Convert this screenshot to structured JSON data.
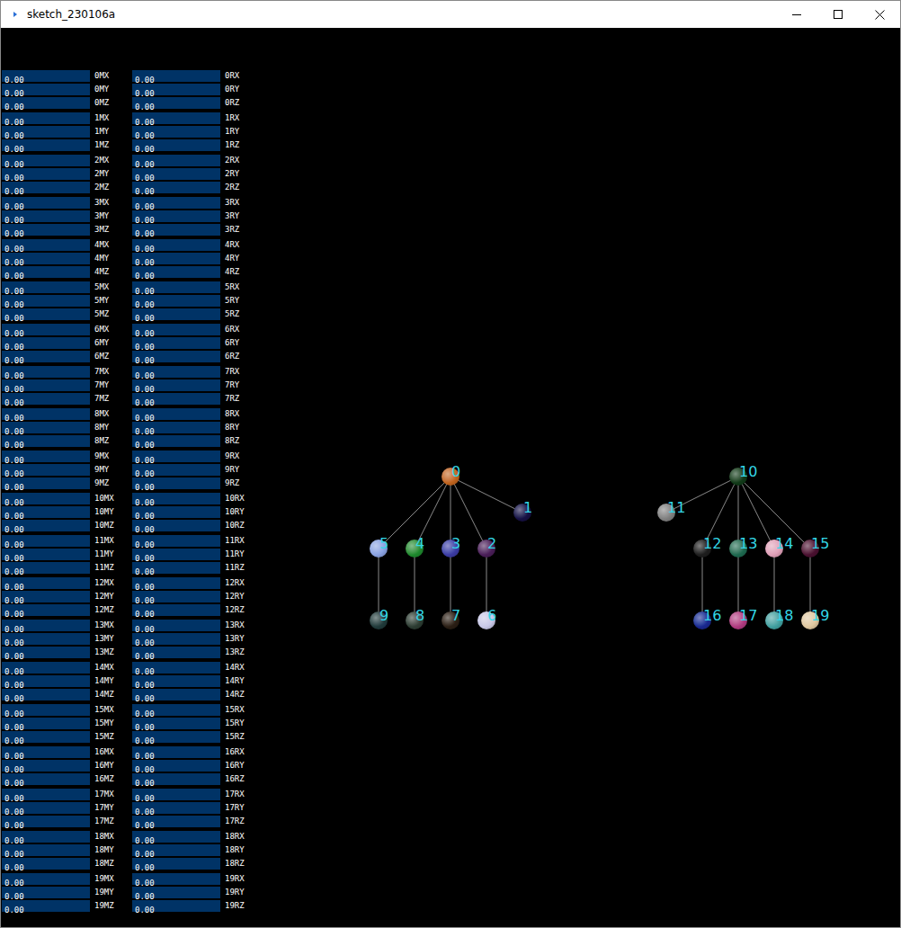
{
  "window": {
    "title": "sketch_230106a"
  },
  "slider_groups": [
    {
      "rows": [
        {
          "move": {
            "value": "0.00",
            "label": "0MX",
            "level": 0
          },
          "rotate": {
            "value": "0.00",
            "label": "0RX",
            "level": 0
          }
        },
        {
          "move": {
            "value": "0.00",
            "label": "0MY",
            "level": 0
          },
          "rotate": {
            "value": "0.00",
            "label": "0RY",
            "level": 0
          }
        },
        {
          "move": {
            "value": "0.00",
            "label": "0MZ",
            "level": 0
          },
          "rotate": {
            "value": "0.00",
            "label": "0RZ",
            "level": 0
          }
        }
      ]
    },
    {
      "rows": [
        {
          "move": {
            "value": "0.00",
            "label": "1MX",
            "level": 0
          },
          "rotate": {
            "value": "0.00",
            "label": "1RX",
            "level": 0
          }
        },
        {
          "move": {
            "value": "0.00",
            "label": "1MY",
            "level": 0
          },
          "rotate": {
            "value": "0.00",
            "label": "1RY",
            "level": 0
          }
        },
        {
          "move": {
            "value": "0.00",
            "label": "1MZ",
            "level": 0
          },
          "rotate": {
            "value": "0.00",
            "label": "1RZ",
            "level": 0
          }
        }
      ]
    },
    {
      "rows": [
        {
          "move": {
            "value": "0.00",
            "label": "2MX",
            "level": 0
          },
          "rotate": {
            "value": "0.00",
            "label": "2RX",
            "level": 0
          }
        },
        {
          "move": {
            "value": "0.00",
            "label": "2MY",
            "level": 0
          },
          "rotate": {
            "value": "0.00",
            "label": "2RY",
            "level": 0
          }
        },
        {
          "move": {
            "value": "0.00",
            "label": "2MZ",
            "level": 0
          },
          "rotate": {
            "value": "0.00",
            "label": "2RZ",
            "level": 0
          }
        }
      ]
    },
    {
      "rows": [
        {
          "move": {
            "value": "0.00",
            "label": "3MX",
            "level": 0
          },
          "rotate": {
            "value": "0.00",
            "label": "3RX",
            "level": 0
          }
        },
        {
          "move": {
            "value": "0.00",
            "label": "3MY",
            "level": 0
          },
          "rotate": {
            "value": "0.00",
            "label": "3RY",
            "level": 0
          }
        },
        {
          "move": {
            "value": "0.00",
            "label": "3MZ",
            "level": 0
          },
          "rotate": {
            "value": "0.00",
            "label": "3RZ",
            "level": 0
          }
        }
      ]
    },
    {
      "rows": [
        {
          "move": {
            "value": "0.00",
            "label": "4MX",
            "level": 0
          },
          "rotate": {
            "value": "0.00",
            "label": "4RX",
            "level": 0
          }
        },
        {
          "move": {
            "value": "0.00",
            "label": "4MY",
            "level": 0
          },
          "rotate": {
            "value": "0.00",
            "label": "4RY",
            "level": 0
          }
        },
        {
          "move": {
            "value": "0.00",
            "label": "4MZ",
            "level": 0
          },
          "rotate": {
            "value": "0.00",
            "label": "4RZ",
            "level": 0
          }
        }
      ]
    },
    {
      "rows": [
        {
          "move": {
            "value": "0.00",
            "label": "5MX",
            "level": 0
          },
          "rotate": {
            "value": "0.00",
            "label": "5RX",
            "level": 0
          }
        },
        {
          "move": {
            "value": "0.00",
            "label": "5MY",
            "level": 0
          },
          "rotate": {
            "value": "0.00",
            "label": "5RY",
            "level": 0
          }
        },
        {
          "move": {
            "value": "0.00",
            "label": "5MZ",
            "level": 0
          },
          "rotate": {
            "value": "0.00",
            "label": "5RZ",
            "level": 0
          }
        }
      ]
    },
    {
      "rows": [
        {
          "move": {
            "value": "0.00",
            "label": "6MX",
            "level": 0
          },
          "rotate": {
            "value": "0.00",
            "label": "6RX",
            "level": 0
          }
        },
        {
          "move": {
            "value": "0.00",
            "label": "6MY",
            "level": 0
          },
          "rotate": {
            "value": "0.00",
            "label": "6RY",
            "level": 0
          }
        },
        {
          "move": {
            "value": "0.00",
            "label": "6MZ",
            "level": 0
          },
          "rotate": {
            "value": "0.00",
            "label": "6RZ",
            "level": 0
          }
        }
      ]
    },
    {
      "rows": [
        {
          "move": {
            "value": "0.00",
            "label": "7MX",
            "level": 0
          },
          "rotate": {
            "value": "0.00",
            "label": "7RX",
            "level": 0
          }
        },
        {
          "move": {
            "value": "0.00",
            "label": "7MY",
            "level": 0
          },
          "rotate": {
            "value": "0.00",
            "label": "7RY",
            "level": 0
          }
        },
        {
          "move": {
            "value": "0.00",
            "label": "7MZ",
            "level": 0
          },
          "rotate": {
            "value": "0.00",
            "label": "7RZ",
            "level": 0
          }
        }
      ]
    },
    {
      "rows": [
        {
          "move": {
            "value": "0.00",
            "label": "8MX",
            "level": 0
          },
          "rotate": {
            "value": "0.00",
            "label": "8RX",
            "level": 0
          }
        },
        {
          "move": {
            "value": "0.00",
            "label": "8MY",
            "level": 0
          },
          "rotate": {
            "value": "0.00",
            "label": "8RY",
            "level": 0
          }
        },
        {
          "move": {
            "value": "0.00",
            "label": "8MZ",
            "level": 0
          },
          "rotate": {
            "value": "0.00",
            "label": "8RZ",
            "level": 0
          }
        }
      ]
    },
    {
      "rows": [
        {
          "move": {
            "value": "0.00",
            "label": "9MX",
            "level": 0
          },
          "rotate": {
            "value": "0.00",
            "label": "9RX",
            "level": 0
          }
        },
        {
          "move": {
            "value": "0.00",
            "label": "9MY",
            "level": 0
          },
          "rotate": {
            "value": "0.00",
            "label": "9RY",
            "level": 0
          }
        },
        {
          "move": {
            "value": "0.00",
            "label": "9MZ",
            "level": 0
          },
          "rotate": {
            "value": "0.00",
            "label": "9RZ",
            "level": 0
          }
        }
      ]
    },
    {
      "rows": [
        {
          "move": {
            "value": "0.00",
            "label": "10MX",
            "level": 0
          },
          "rotate": {
            "value": "0.00",
            "label": "10RX",
            "level": 0
          }
        },
        {
          "move": {
            "value": "0.00",
            "label": "10MY",
            "level": 0
          },
          "rotate": {
            "value": "0.00",
            "label": "10RY",
            "level": 0
          }
        },
        {
          "move": {
            "value": "0.00",
            "label": "10MZ",
            "level": 0
          },
          "rotate": {
            "value": "0.00",
            "label": "10RZ",
            "level": 0
          }
        }
      ]
    },
    {
      "rows": [
        {
          "move": {
            "value": "0.00",
            "label": "11MX",
            "level": 0
          },
          "rotate": {
            "value": "0.00",
            "label": "11RX",
            "level": 0
          }
        },
        {
          "move": {
            "value": "0.00",
            "label": "11MY",
            "level": 0
          },
          "rotate": {
            "value": "0.00",
            "label": "11RY",
            "level": 0
          }
        },
        {
          "move": {
            "value": "0.00",
            "label": "11MZ",
            "level": 0
          },
          "rotate": {
            "value": "0.00",
            "label": "11RZ",
            "level": 0
          }
        }
      ]
    },
    {
      "rows": [
        {
          "move": {
            "value": "0.00",
            "label": "12MX",
            "level": 0
          },
          "rotate": {
            "value": "0.00",
            "label": "12RX",
            "level": 0
          }
        },
        {
          "move": {
            "value": "0.00",
            "label": "12MY",
            "level": 0
          },
          "rotate": {
            "value": "0.00",
            "label": "12RY",
            "level": 0
          }
        },
        {
          "move": {
            "value": "0.00",
            "label": "12MZ",
            "level": 0
          },
          "rotate": {
            "value": "0.00",
            "label": "12RZ",
            "level": 0
          }
        }
      ]
    },
    {
      "rows": [
        {
          "move": {
            "value": "0.00",
            "label": "13MX",
            "level": 0
          },
          "rotate": {
            "value": "0.00",
            "label": "13RX",
            "level": 0
          }
        },
        {
          "move": {
            "value": "0.00",
            "label": "13MY",
            "level": 0
          },
          "rotate": {
            "value": "0.00",
            "label": "13RY",
            "level": 0
          }
        },
        {
          "move": {
            "value": "0.00",
            "label": "13MZ",
            "level": 0
          },
          "rotate": {
            "value": "0.00",
            "label": "13RZ",
            "level": 0
          }
        }
      ]
    },
    {
      "rows": [
        {
          "move": {
            "value": "0.00",
            "label": "14MX",
            "level": 0
          },
          "rotate": {
            "value": "0.00",
            "label": "14RX",
            "level": 0
          }
        },
        {
          "move": {
            "value": "0.00",
            "label": "14MY",
            "level": 0
          },
          "rotate": {
            "value": "0.00",
            "label": "14RY",
            "level": 0
          }
        },
        {
          "move": {
            "value": "0.00",
            "label": "14MZ",
            "level": 0
          },
          "rotate": {
            "value": "0.00",
            "label": "14RZ",
            "level": 0
          }
        }
      ]
    },
    {
      "rows": [
        {
          "move": {
            "value": "0.00",
            "label": "15MX",
            "level": 0
          },
          "rotate": {
            "value": "0.00",
            "label": "15RX",
            "level": 0
          }
        },
        {
          "move": {
            "value": "0.00",
            "label": "15MY",
            "level": 0
          },
          "rotate": {
            "value": "0.00",
            "label": "15RY",
            "level": 0
          }
        },
        {
          "move": {
            "value": "0.00",
            "label": "15MZ",
            "level": 0
          },
          "rotate": {
            "value": "0.00",
            "label": "15RZ",
            "level": 0
          }
        }
      ]
    },
    {
      "rows": [
        {
          "move": {
            "value": "0.00",
            "label": "16MX",
            "level": 0
          },
          "rotate": {
            "value": "0.00",
            "label": "16RX",
            "level": 0
          }
        },
        {
          "move": {
            "value": "0.00",
            "label": "16MY",
            "level": 0
          },
          "rotate": {
            "value": "0.00",
            "label": "16RY",
            "level": 0
          }
        },
        {
          "move": {
            "value": "0.00",
            "label": "16MZ",
            "level": 0
          },
          "rotate": {
            "value": "0.00",
            "label": "16RZ",
            "level": 0
          }
        }
      ]
    },
    {
      "rows": [
        {
          "move": {
            "value": "0.00",
            "label": "17MX",
            "level": 0
          },
          "rotate": {
            "value": "0.00",
            "label": "17RX",
            "level": 0
          }
        },
        {
          "move": {
            "value": "0.00",
            "label": "17MY",
            "level": 0
          },
          "rotate": {
            "value": "0.00",
            "label": "17RY",
            "level": 0
          }
        },
        {
          "move": {
            "value": "0.00",
            "label": "17MZ",
            "level": 0
          },
          "rotate": {
            "value": "0.00",
            "label": "17RZ",
            "level": 0
          }
        }
      ]
    },
    {
      "rows": [
        {
          "move": {
            "value": "0.00",
            "label": "18MX",
            "level": 0
          },
          "rotate": {
            "value": "0.00",
            "label": "18RX",
            "level": 0
          }
        },
        {
          "move": {
            "value": "0.00",
            "label": "18MY",
            "level": 0
          },
          "rotate": {
            "value": "0.00",
            "label": "18RY",
            "level": 0
          }
        },
        {
          "move": {
            "value": "0.00",
            "label": "18MZ",
            "level": 0
          },
          "rotate": {
            "value": "0.00",
            "label": "18RZ",
            "level": 0
          }
        }
      ]
    },
    {
      "rows": [
        {
          "move": {
            "value": "0.00",
            "label": "19MX",
            "level": 0
          },
          "rotate": {
            "value": "0.00",
            "label": "19RX",
            "level": 0
          }
        },
        {
          "move": {
            "value": "0.00",
            "label": "19MY",
            "level": 0
          },
          "rotate": {
            "value": "0.00",
            "label": "19RY",
            "level": 0
          }
        },
        {
          "move": {
            "value": "0.00",
            "label": "19MZ",
            "level": 0
          },
          "rotate": {
            "value": "0.00",
            "label": "19RZ",
            "level": 0
          }
        }
      ]
    }
  ],
  "diagram": {
    "nodes": [
      {
        "label": "0",
        "color": "#c0641e"
      },
      {
        "label": "1",
        "color": "#161044"
      },
      {
        "label": "2",
        "color": "#4a1e58"
      },
      {
        "label": "3",
        "color": "#3c3ca4"
      },
      {
        "label": "4",
        "color": "#1e8a2e"
      },
      {
        "label": "5",
        "color": "#8aa2e2"
      },
      {
        "label": "6",
        "color": "#c8c8e8"
      },
      {
        "label": "7",
        "color": "#2a1e14"
      },
      {
        "label": "8",
        "color": "#2c3c32"
      },
      {
        "label": "9",
        "color": "#203a3a"
      },
      {
        "label": "10",
        "color": "#103a18"
      },
      {
        "label": "11",
        "color": "#808080"
      },
      {
        "label": "12",
        "color": "#1e1e1e"
      },
      {
        "label": "13",
        "color": "#1e6a50"
      },
      {
        "label": "14",
        "color": "#e0a0b8"
      },
      {
        "label": "15",
        "color": "#4a1030"
      },
      {
        "label": "16",
        "color": "#1a2890"
      },
      {
        "label": "17",
        "color": "#b03a80"
      },
      {
        "label": "18",
        "color": "#40a0a0"
      },
      {
        "label": "19",
        "color": "#e0c8a0"
      }
    ],
    "edges": [
      [
        "0",
        "1"
      ],
      [
        "0",
        "2"
      ],
      [
        "0",
        "3"
      ],
      [
        "0",
        "4"
      ],
      [
        "0",
        "5"
      ],
      [
        "5",
        "9"
      ],
      [
        "4",
        "8"
      ],
      [
        "3",
        "7"
      ],
      [
        "2",
        "6"
      ],
      [
        "10",
        "11"
      ],
      [
        "10",
        "12"
      ],
      [
        "10",
        "13"
      ],
      [
        "10",
        "14"
      ],
      [
        "10",
        "15"
      ],
      [
        "12",
        "16"
      ],
      [
        "13",
        "17"
      ],
      [
        "14",
        "18"
      ],
      [
        "15",
        "19"
      ]
    ]
  }
}
